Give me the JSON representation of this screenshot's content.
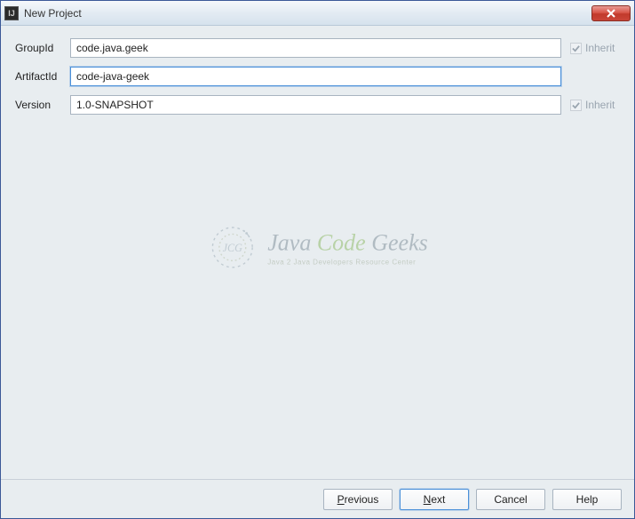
{
  "window": {
    "title": "New Project"
  },
  "form": {
    "groupId": {
      "label": "GroupId",
      "value": "code.java.geek",
      "inherit_label": "Inherit"
    },
    "artifactId": {
      "label": "ArtifactId",
      "value": "code-java-geek"
    },
    "version": {
      "label": "Version",
      "value": "1.0-SNAPSHOT",
      "inherit_label": "Inherit"
    }
  },
  "watermark": {
    "main_part1": "Java ",
    "main_accent": "Code",
    "main_part2": " Geeks",
    "sub": "Java 2 Java Developers Resource Center"
  },
  "footer": {
    "previous_pre": "P",
    "previous_rest": "revious",
    "next_pre": "N",
    "next_rest": "ext",
    "cancel": "Cancel",
    "help": "Help"
  }
}
